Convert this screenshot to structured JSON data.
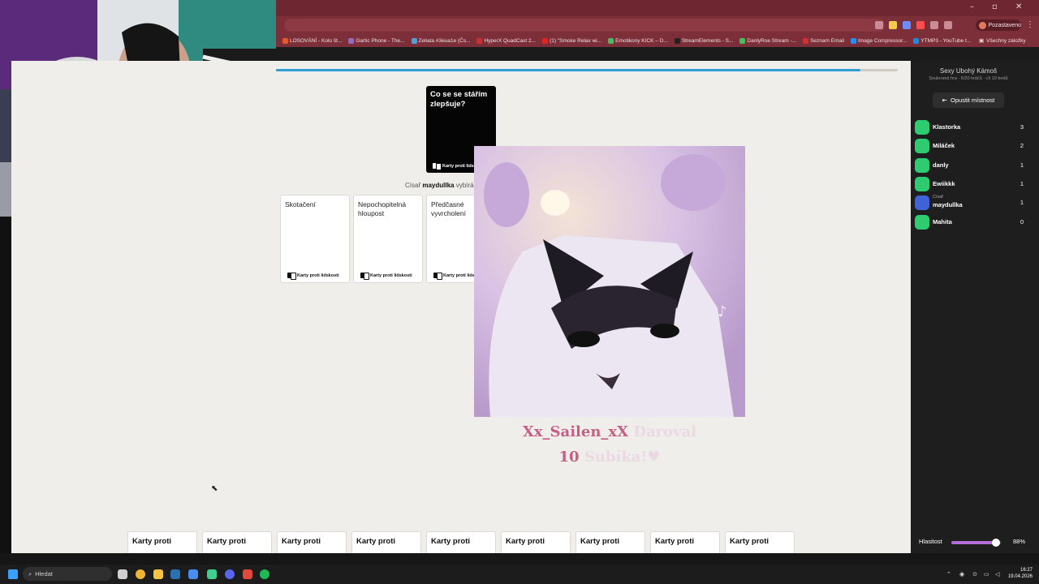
{
  "browser": {
    "window_controls": [
      "–",
      "▫",
      "✕"
    ],
    "bookmarks": [
      {
        "label": "LOSOVÁNÍ - Kolo št...",
        "color": "#e4572e"
      },
      {
        "label": "Gartic Phone - The...",
        "color": "#8e6cc8"
      },
      {
        "label": "Zeliata #3eua1e (Čs...",
        "color": "#4aa3df"
      },
      {
        "label": "HyperX QuadCast 2...",
        "color": "#d12f2f"
      },
      {
        "label": "(1) \"Smoke Relax wi...",
        "color": "#e02424"
      },
      {
        "label": "Emotikony KICK – D...",
        "color": "#3fbf5a"
      },
      {
        "label": "StreamElements - S...",
        "color": "#222222"
      },
      {
        "label": "DanlyRoe Stream -...",
        "color": "#34c759"
      },
      {
        "label": "Seznam Email",
        "color": "#d32f2f"
      },
      {
        "label": "Image Compressor...",
        "color": "#2d8cf0"
      },
      {
        "label": "YTMP3 - YouTube t...",
        "color": "#1e88e5"
      }
    ],
    "all_bookmarks": "Všechny záložky",
    "profile_label": "Pozastaveno"
  },
  "game": {
    "progress": 0.94,
    "black_card": "Co se se stářím zlepšuje?",
    "brand": "Karty proti lidskosti",
    "czar_prefix": "Císař",
    "czar_name": "maydullka",
    "czar_suffix": "vybírá",
    "played_cards": [
      {
        "text": "Skotačení"
      },
      {
        "text": "Nepochopitelná hloupost"
      },
      {
        "text": "Předčasné vyvrcholení"
      }
    ],
    "hand_card_label": "Karty proti",
    "hand_count": 9
  },
  "donation": {
    "user": "Xx_Sailen_xX",
    "verb": "Daroval",
    "amount": "10",
    "item": "Subíka!♥"
  },
  "sidebar": {
    "room_name": "Sexy Ubohý Kámoš",
    "room_meta": "Soukromá hra · 6/20 hráčů · cíl 10 bodů",
    "leave_button": "Opustit místnost",
    "players": [
      {
        "name": "Klastorka",
        "role": "",
        "score": "3",
        "color": "#2ecc71"
      },
      {
        "name": "Miláček",
        "role": "",
        "score": "2",
        "color": "#2ecc71"
      },
      {
        "name": "danly",
        "role": "",
        "score": "1",
        "color": "#2ecc71"
      },
      {
        "name": "Ewiikkk",
        "role": "",
        "score": "1",
        "color": "#2ecc71"
      },
      {
        "name": "maydullka",
        "role": "Císař",
        "score": "1",
        "color": "#3f62d8"
      },
      {
        "name": "Mahita",
        "role": "",
        "score": "0",
        "color": "#2ecc71"
      }
    ],
    "volume_label": "Hlasitost",
    "volume": 0.88,
    "volume_text": "88%"
  },
  "taskbar": {
    "search_placeholder": "Hledat",
    "time": "16:27",
    "date": "19.04.2026"
  }
}
